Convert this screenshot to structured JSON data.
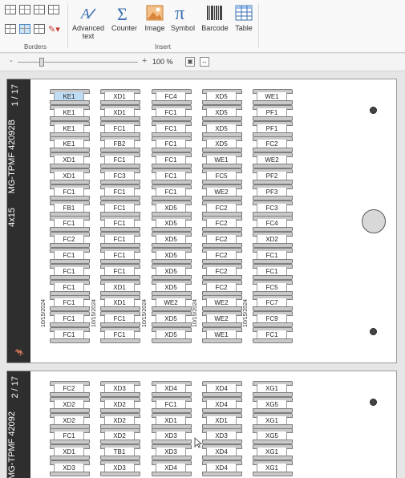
{
  "ribbon": {
    "groups": {
      "borders": "Borders",
      "insert": "Insert"
    },
    "tools": [
      {
        "name": "advanced-text",
        "label": "Advanced text",
        "icon": "advanced-text-icon"
      },
      {
        "name": "counter",
        "label": "Counter",
        "icon": "sigma-icon"
      },
      {
        "name": "image",
        "label": "Image",
        "icon": "image-icon"
      },
      {
        "name": "symbol",
        "label": "Symbol",
        "icon": "pi-icon"
      },
      {
        "name": "barcode",
        "label": "Barcode",
        "icon": "barcode-icon"
      },
      {
        "name": "table",
        "label": "Table",
        "icon": "table-icon"
      }
    ]
  },
  "zoom": {
    "minus": "-",
    "plus": "+",
    "percent": "100 %",
    "level_fraction": 0.2
  },
  "sheets": [
    {
      "page": "1 / 17",
      "title": "MG-TPMF 42092B",
      "format": "4x15",
      "date": "10/15/2024",
      "columns": [
        [
          "KE1",
          "KE1",
          "KE1",
          "KE1",
          "XD1",
          "XD1",
          "FC1",
          "FB1",
          "FC1",
          "FC2",
          "FC1",
          "FC1",
          "FC1",
          "FC1",
          "FC1",
          "FC1"
        ],
        [
          "XD1",
          "XD1",
          "FC1",
          "FB2",
          "FC1",
          "FC3",
          "FC1",
          "FC1",
          "FC1",
          "FC1",
          "FC1",
          "FC1",
          "XD1",
          "XD1",
          "FC1",
          "FC1"
        ],
        [
          "FC4",
          "FC1",
          "FC1",
          "FC1",
          "FC1",
          "FC1",
          "FC1",
          "XD5",
          "XD5",
          "XD5",
          "XD5",
          "XD5",
          "XD5",
          "WE2",
          "XD5",
          "XD5"
        ],
        [
          "XD5",
          "XD5",
          "XD5",
          "XD5",
          "WE1",
          "FC5",
          "WE2",
          "FC2",
          "FC2",
          "FC2",
          "FC2",
          "FC2",
          "FC2",
          "WE2",
          "WE2",
          "WE1"
        ],
        [
          "WE1",
          "PF1",
          "PF1",
          "FC2",
          "WE2",
          "PF2",
          "PF3",
          "FC3",
          "FC4",
          "XD2",
          "FC1",
          "FC1",
          "FC5",
          "FC7",
          "FC9",
          "FC1"
        ]
      ]
    },
    {
      "page": "2 / 17",
      "title": "MG-TPMF 42092",
      "columns": [
        [
          "FC2",
          "XD2",
          "XD2",
          "FC1",
          "XD1",
          "XD3"
        ],
        [
          "XD3",
          "XD2",
          "XD2",
          "XD2",
          "TB1",
          "XD3"
        ],
        [
          "XD4",
          "FC1",
          "XD1",
          "XD3",
          "XD3",
          "XD4"
        ],
        [
          "XD4",
          "XD4",
          "XD1",
          "XD3",
          "XD4",
          "XD4"
        ],
        [
          "XG1",
          "XG5",
          "XG1",
          "XG5",
          "XG1",
          "XG1"
        ]
      ]
    }
  ]
}
